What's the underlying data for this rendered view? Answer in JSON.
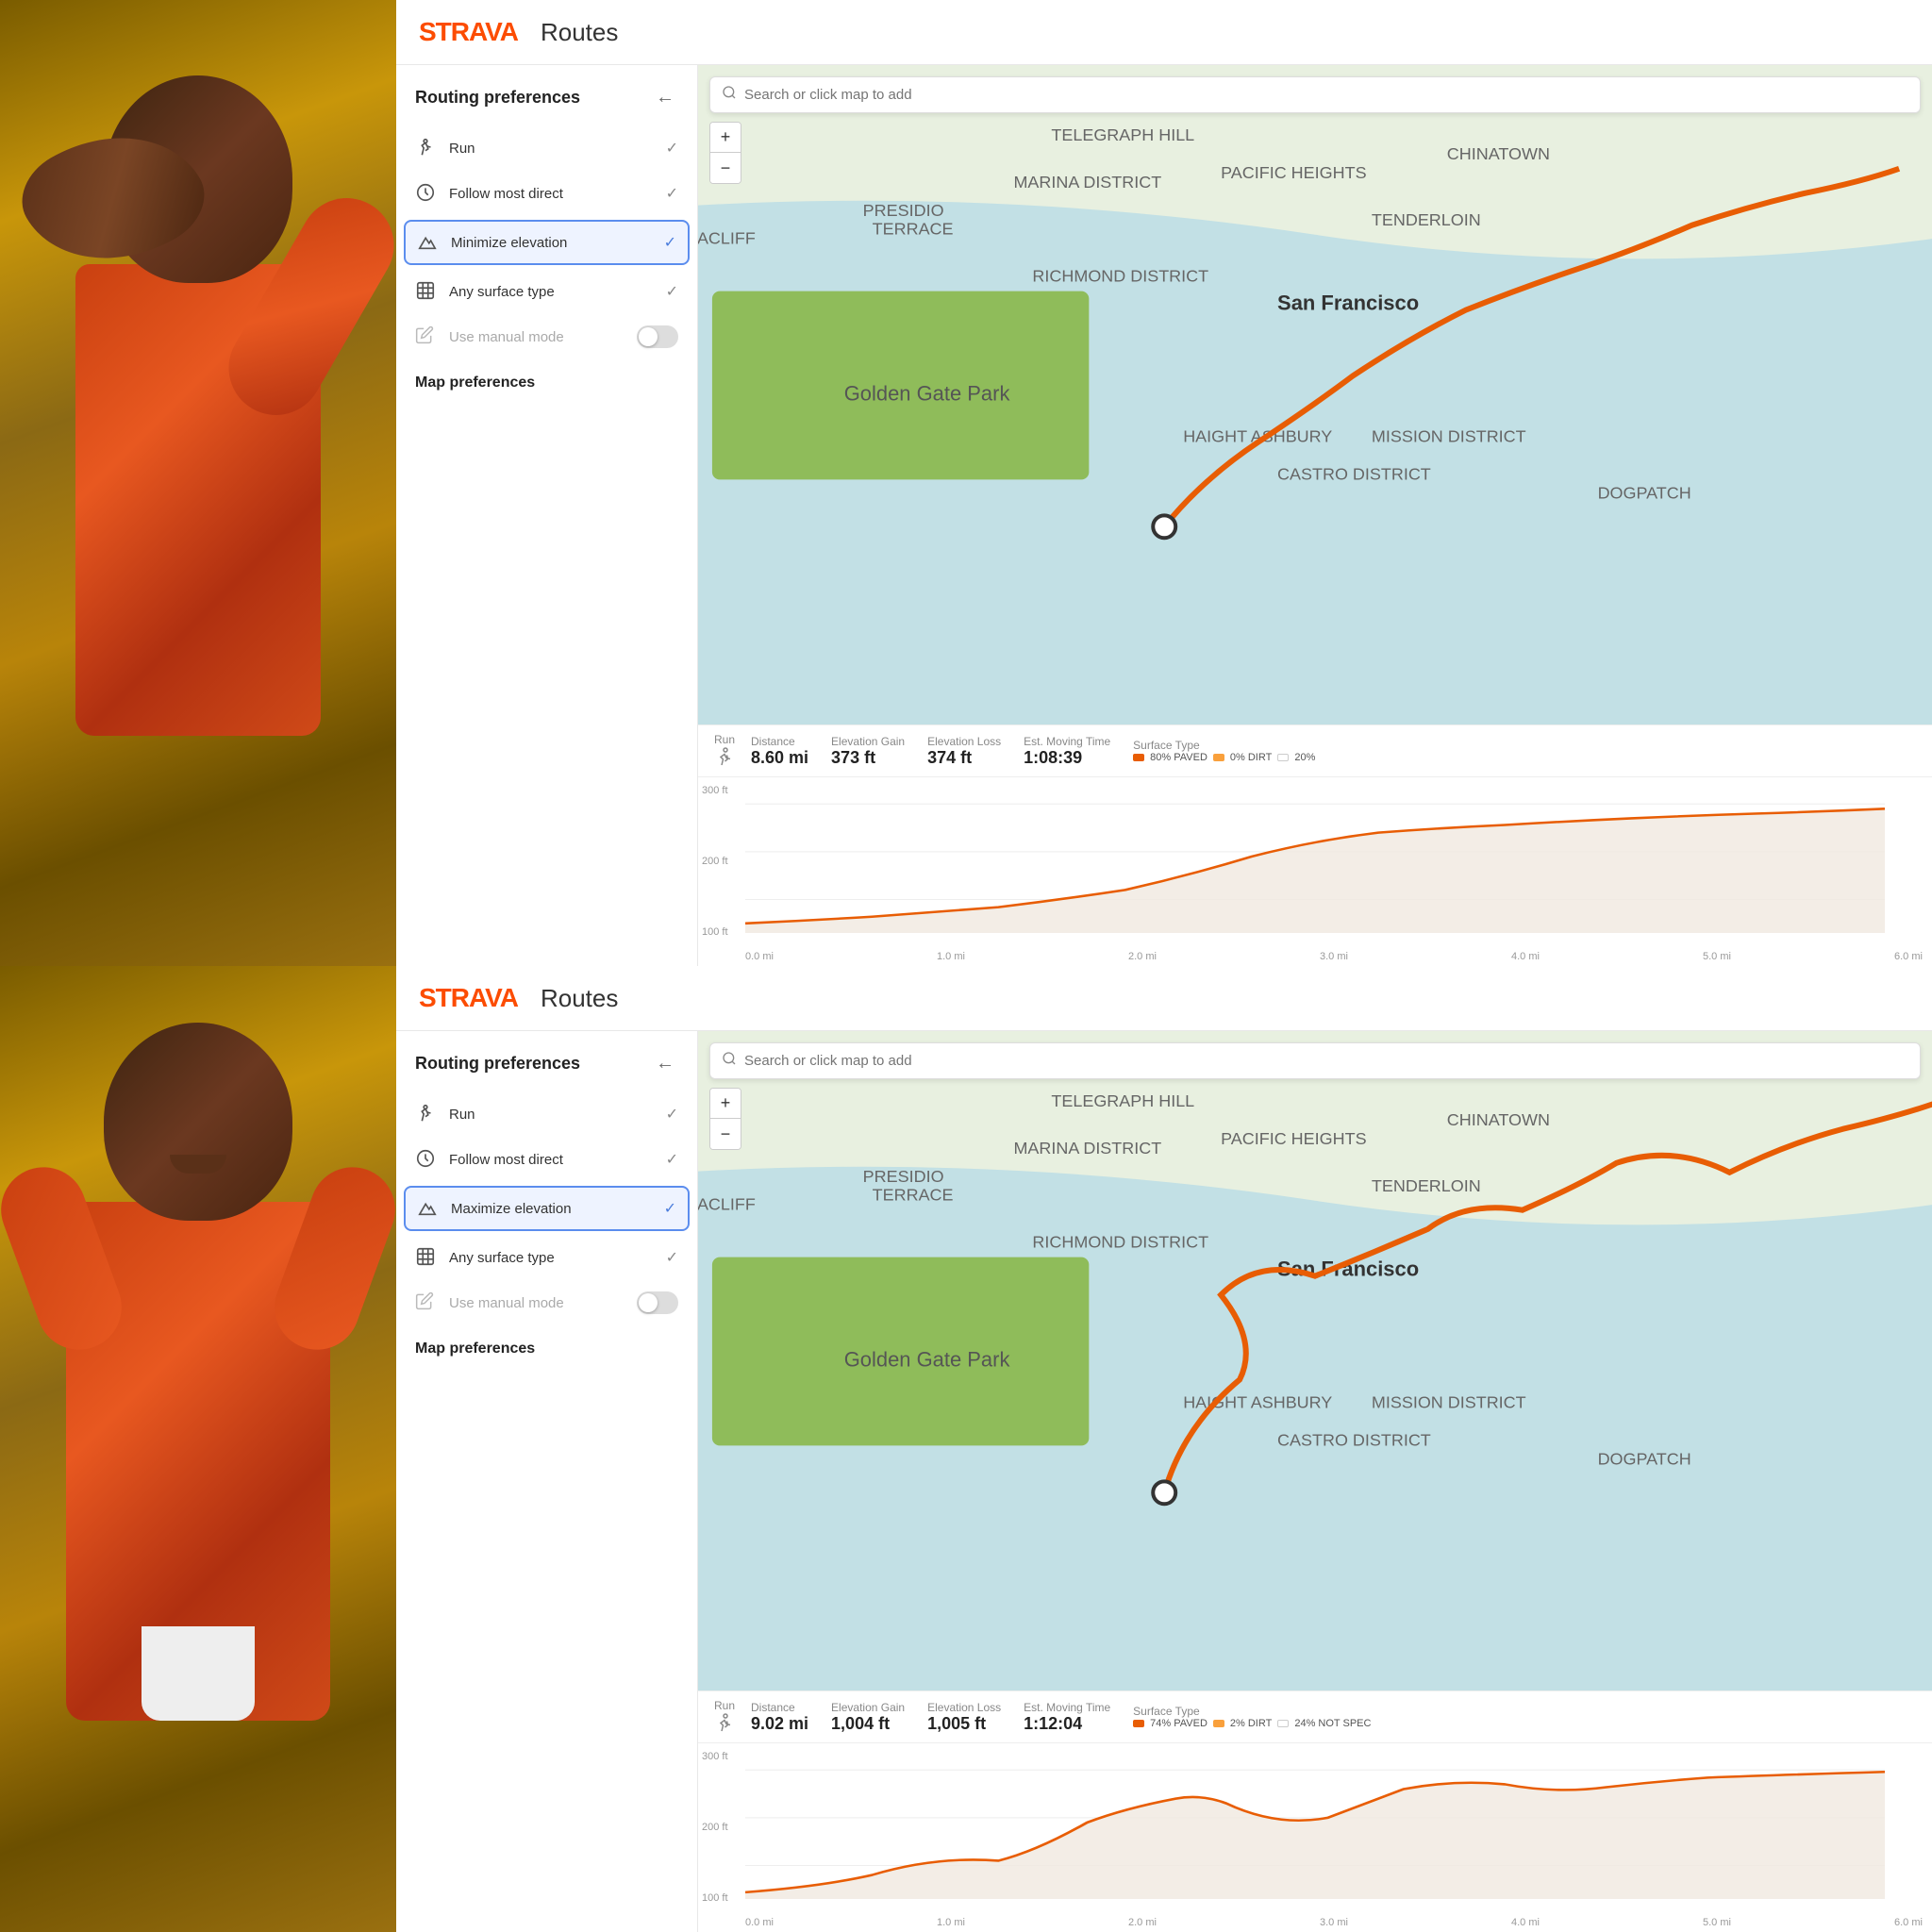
{
  "app": {
    "logo": "STRAVA",
    "title": "Routes"
  },
  "top_panel": {
    "header": {
      "logo": "STRAVA",
      "title": "Routes"
    },
    "sidebar": {
      "section_title": "Routing preferences",
      "back_btn": "←",
      "items": [
        {
          "id": "run",
          "label": "Run",
          "icon": "run",
          "checked": true,
          "selected": false
        },
        {
          "id": "follow-most-direct",
          "label": "Follow most direct",
          "icon": "clock",
          "checked": true,
          "selected": false
        },
        {
          "id": "minimize-elevation",
          "label": "Minimize elevation",
          "icon": "mountain",
          "checked": true,
          "selected": true
        },
        {
          "id": "any-surface-type",
          "label": "Any surface type",
          "icon": "surface",
          "checked": true,
          "selected": false
        }
      ],
      "manual_mode": {
        "label": "Use manual mode",
        "enabled": false
      },
      "map_prefs_title": "Map preferences"
    },
    "map": {
      "search_placeholder": "Search or click map to add"
    },
    "stats": {
      "type_label": "Run",
      "distance_label": "Distance",
      "distance_value": "8.60 mi",
      "elev_gain_label": "Elevation Gain",
      "elev_gain_value": "373 ft",
      "elev_loss_label": "Elevation Loss",
      "elev_loss_value": "374 ft",
      "moving_time_label": "Est. Moving Time",
      "moving_time_value": "1:08:39",
      "surface_type_label": "Surface Type",
      "surface_legend": [
        {
          "label": "80% PAVED",
          "color": "#e85d04"
        },
        {
          "label": "0% DIRT",
          "color": "#f9a03c"
        },
        {
          "label": "20%",
          "color": "#fff",
          "border": "#ccc"
        }
      ]
    },
    "chart": {
      "y_labels": [
        "300 ft",
        "200 ft",
        "100 ft"
      ],
      "x_labels": [
        "0.0 mi",
        "1.0 mi",
        "2.0 mi",
        "3.0 mi",
        "4.0 mi",
        "5.0 mi",
        "6.0 mi"
      ]
    }
  },
  "bottom_panel": {
    "header": {
      "logo": "STRAVA",
      "title": "Routes"
    },
    "sidebar": {
      "section_title": "Routing preferences",
      "back_btn": "←",
      "items": [
        {
          "id": "run",
          "label": "Run",
          "icon": "run",
          "checked": true,
          "selected": false
        },
        {
          "id": "follow-most-direct",
          "label": "Follow most direct",
          "icon": "clock",
          "checked": true,
          "selected": false
        },
        {
          "id": "maximize-elevation",
          "label": "Maximize elevation",
          "icon": "mountain",
          "checked": true,
          "selected": true
        },
        {
          "id": "any-surface-type",
          "label": "Any surface type",
          "icon": "surface",
          "checked": true,
          "selected": false
        }
      ],
      "manual_mode": {
        "label": "Use manual mode",
        "enabled": false
      },
      "map_prefs_title": "Map preferences"
    },
    "map": {
      "search_placeholder": "Search or click map to add"
    },
    "stats": {
      "type_label": "Run",
      "distance_label": "Distance",
      "distance_value": "9.02 mi",
      "elev_gain_label": "Elevation Gain",
      "elev_gain_value": "1,004 ft",
      "elev_loss_label": "Elevation Loss",
      "elev_loss_value": "1,005 ft",
      "moving_time_label": "Est. Moving Time",
      "moving_time_value": "1:12:04",
      "surface_type_label": "Surface Type",
      "surface_legend": [
        {
          "label": "74% PAVED",
          "color": "#e85d04"
        },
        {
          "label": "2% DIRT",
          "color": "#f9a03c"
        },
        {
          "label": "24% NOT SPEC",
          "color": "#fff",
          "border": "#ccc"
        }
      ]
    },
    "chart": {
      "y_labels": [
        "300 ft",
        "200 ft",
        "100 ft"
      ],
      "x_labels": [
        "0.0 mi",
        "1.0 mi",
        "2.0 mi",
        "3.0 mi",
        "4.0 mi",
        "5.0 mi",
        "6.0 mi"
      ]
    }
  },
  "icons": {
    "run": "🏃",
    "clock": "🕐",
    "mountain": "⛰",
    "surface": "⬜",
    "search": "🔍",
    "back": "←",
    "plus": "+",
    "minus": "−",
    "pencil": "✏"
  }
}
